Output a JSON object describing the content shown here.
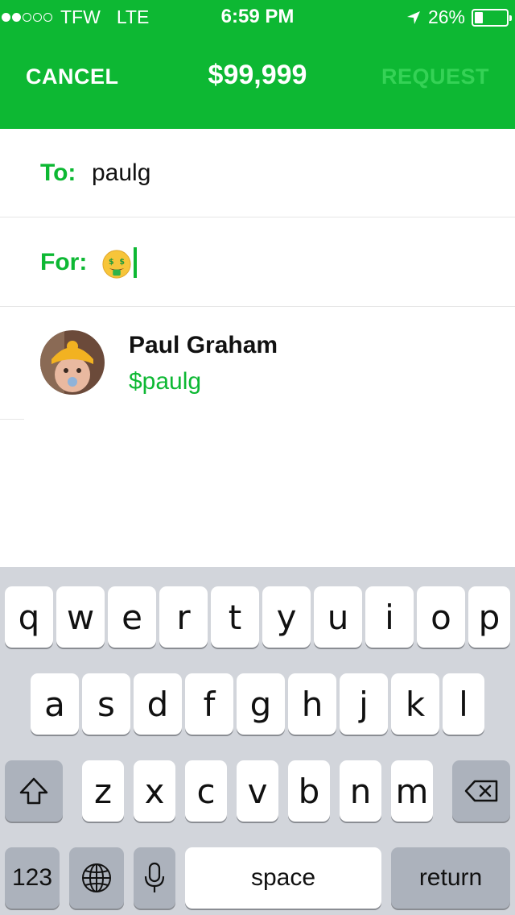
{
  "status_bar": {
    "carrier": "TFW",
    "network": "LTE",
    "time": "6:59 PM",
    "battery_text": "26%",
    "battery_level": 0.26,
    "signal_bars": 2,
    "icons": [
      "signal-dots-icon",
      "location-arrow-icon",
      "battery-icon"
    ]
  },
  "nav": {
    "cancel_label": "CANCEL",
    "amount": "$99,999",
    "request_label": "REQUEST"
  },
  "form": {
    "to_label": "To:",
    "to_value": "paulg",
    "for_label": "For:",
    "for_value_icon": "money-mouth-face-emoji"
  },
  "suggestion": {
    "name": "Paul Graham",
    "handle": "$paulg"
  },
  "keyboard": {
    "row1": [
      "q",
      "w",
      "e",
      "r",
      "t",
      "y",
      "u",
      "i",
      "o",
      "p"
    ],
    "row2": [
      "a",
      "s",
      "d",
      "f",
      "g",
      "h",
      "j",
      "k",
      "l"
    ],
    "row3": [
      "z",
      "x",
      "c",
      "v",
      "b",
      "n",
      "m"
    ],
    "numbers_label": "123",
    "space_label": "space",
    "return_label": "return",
    "icons": [
      "shift-icon",
      "backspace-icon",
      "globe-icon",
      "microphone-icon"
    ]
  },
  "colors": {
    "brand_green": "#0db833",
    "request_disabled": "#35d256",
    "keyboard_bg": "#d2d5db"
  }
}
